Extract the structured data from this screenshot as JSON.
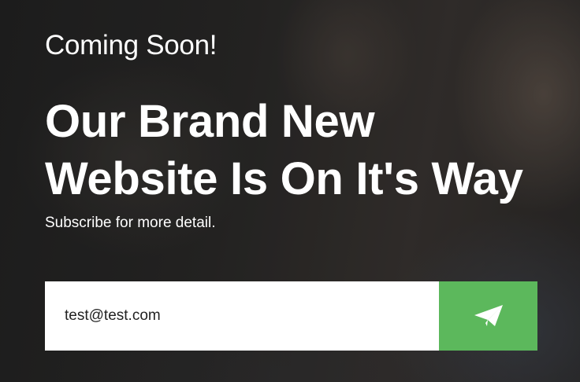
{
  "hero": {
    "kicker": "Coming Soon!",
    "headline_line1": "Our Brand New",
    "headline_line2": "Website Is On It's Way",
    "subtext": "Subscribe for more detail."
  },
  "subscribe": {
    "email_value": "test@test.com",
    "button_icon": "paper-plane-icon",
    "button_color": "#5cb85c"
  }
}
